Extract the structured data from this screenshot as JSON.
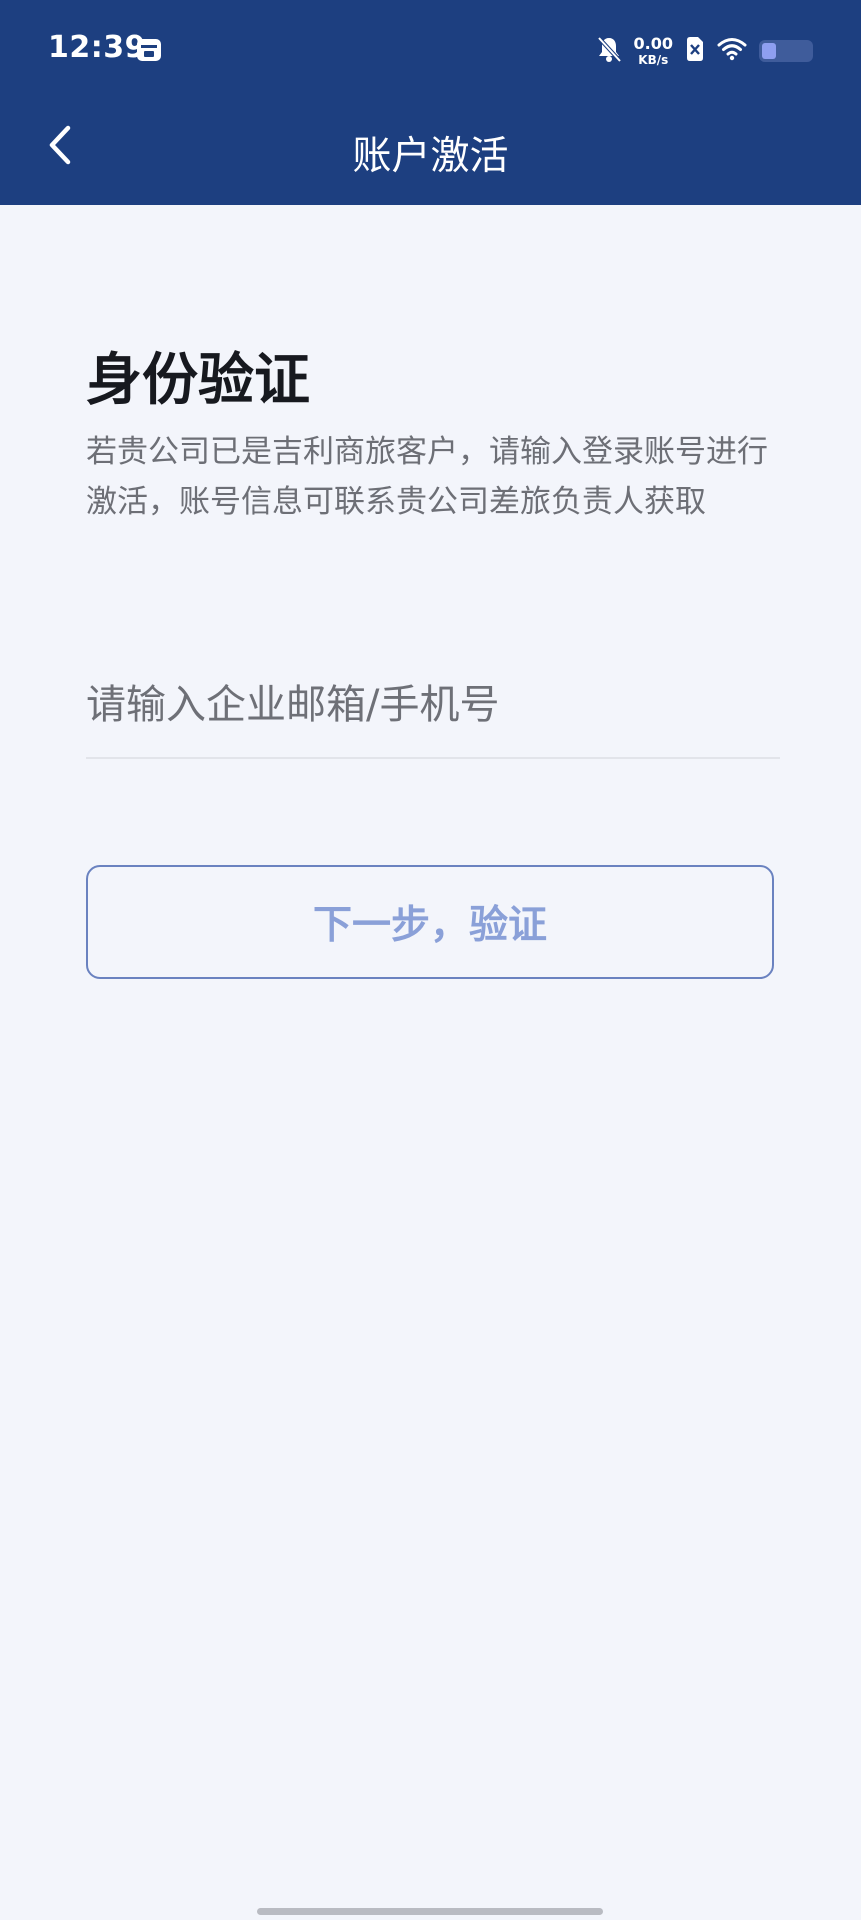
{
  "status_bar": {
    "time": "12:39",
    "net_speed_value": "0.00",
    "net_speed_unit": "KB/s",
    "battery_level": 0.3,
    "icons": [
      "calendar-icon",
      "bell-muted-icon",
      "sim-off-icon",
      "wifi-icon",
      "battery-icon"
    ]
  },
  "header": {
    "title": "账户激活",
    "back_icon": "chevron-left-icon"
  },
  "main": {
    "title": "身份验证",
    "description": "若贵公司已是吉利商旅客户，请输入登录账号进行激活，账号信息可联系贵公司差旅负责人获取",
    "input_placeholder": "请输入企业邮箱/手机号",
    "input_value": "",
    "next_button_label": "下一步，验证"
  },
  "colors": {
    "header_bg": "#1d3f80",
    "page_bg": "#f3f5fb",
    "button_border": "#6a82c0",
    "button_text": "#8aa0d8"
  }
}
